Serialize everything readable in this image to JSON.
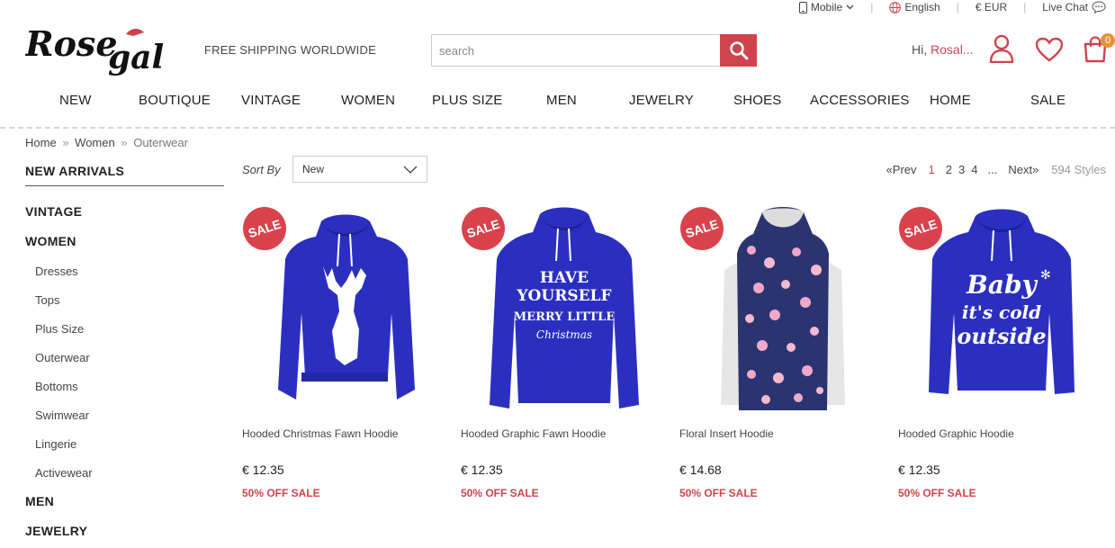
{
  "topbar": {
    "mobile_label": "Mobile",
    "language_label": "English",
    "currency_label": "€ EUR",
    "chat_label": "Live Chat"
  },
  "header": {
    "logo_text": "Rosegal",
    "tagline": "FREE SHIPPING WORLDWIDE",
    "search_placeholder": "search",
    "greeting": "Hi,",
    "user_name": "Rosal...",
    "cart_count": "0"
  },
  "nav": {
    "items": [
      "NEW",
      "BOUTIQUE",
      "VINTAGE",
      "WOMEN",
      "PLUS SIZE",
      "MEN",
      "JEWELRY",
      "SHOES",
      "ACCESSORIES",
      "HOME",
      "SALE"
    ]
  },
  "breadcrumb": {
    "home": "Home",
    "women": "Women",
    "current": "Outerwear",
    "separator": "»"
  },
  "sidebar": {
    "new_arrivals": "NEW ARRIVALS",
    "vintage": "VINTAGE",
    "women": "WOMEN",
    "subs": [
      "Dresses",
      "Tops",
      "Plus Size",
      "Outerwear",
      "Bottoms",
      "Swimwear",
      "Lingerie",
      "Activewear"
    ],
    "men": "MEN",
    "jewelry": "JEWELRY"
  },
  "sort": {
    "label": "Sort By",
    "selected": "New"
  },
  "pager": {
    "prev": "«Prev",
    "pages": [
      "1",
      "2",
      "3",
      "4"
    ],
    "ellipsis": "...",
    "next": "Next»",
    "count": "594 Styles"
  },
  "products": [
    {
      "name": "Hooded Christmas Fawn Hoodie",
      "price": "€ 12.35",
      "discount": "50% OFF SALE",
      "badge": "SALE"
    },
    {
      "name": "Hooded Graphic Fawn Hoodie",
      "price": "€ 12.35",
      "discount": "50% OFF SALE",
      "badge": "SALE"
    },
    {
      "name": "Floral Insert Hoodie",
      "price": "€ 14.68",
      "discount": "50% OFF SALE",
      "badge": "SALE"
    },
    {
      "name": "Hooded Graphic Hoodie",
      "price": "€ 12.35",
      "discount": "50% OFF SALE",
      "badge": "SALE"
    }
  ],
  "colors": {
    "accent": "#d0434c",
    "hoodie_blue": "#2b2fc0",
    "badge": "#d9424c",
    "cart_badge": "#e8913a"
  }
}
